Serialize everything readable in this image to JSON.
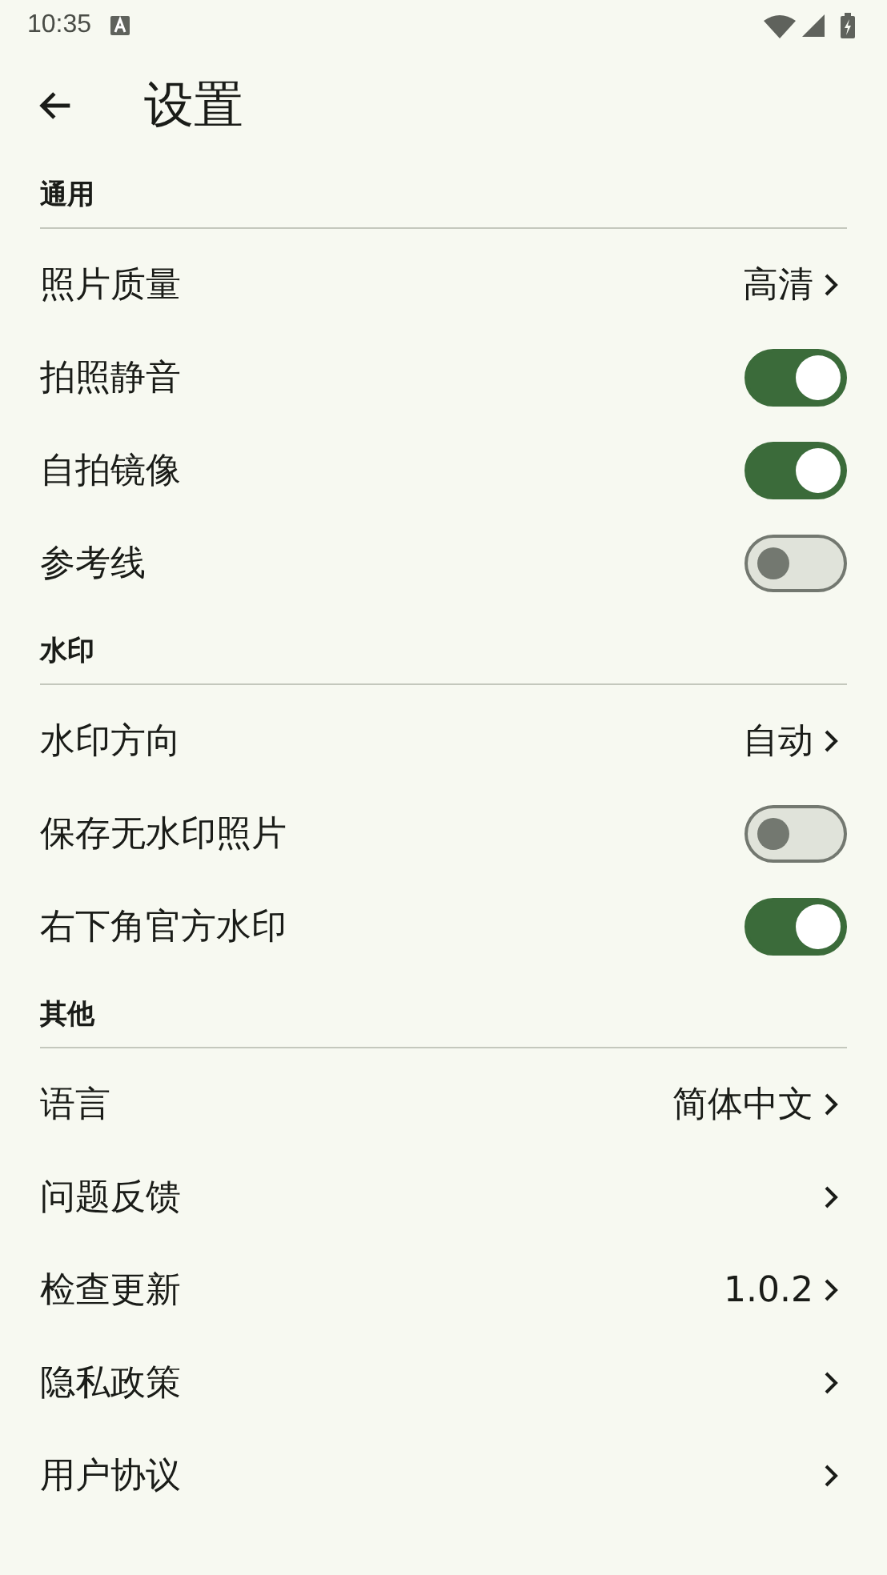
{
  "status_bar": {
    "time": "10:35"
  },
  "header": {
    "title": "设置"
  },
  "sections": [
    {
      "title": "通用",
      "items": [
        {
          "kind": "link",
          "label": "照片质量",
          "value": "高清"
        },
        {
          "kind": "toggle",
          "label": "拍照静音",
          "on": true
        },
        {
          "kind": "toggle",
          "label": "自拍镜像",
          "on": true
        },
        {
          "kind": "toggle",
          "label": "参考线",
          "on": false
        }
      ]
    },
    {
      "title": "水印",
      "items": [
        {
          "kind": "link",
          "label": "水印方向",
          "value": "自动"
        },
        {
          "kind": "toggle",
          "label": "保存无水印照片",
          "on": false
        },
        {
          "kind": "toggle",
          "label": "右下角官方水印",
          "on": true
        }
      ]
    },
    {
      "title": "其他",
      "items": [
        {
          "kind": "link",
          "label": "语言",
          "value": "简体中文"
        },
        {
          "kind": "link",
          "label": "问题反馈"
        },
        {
          "kind": "link",
          "label": "检查更新",
          "value": "1.0.2"
        },
        {
          "kind": "link",
          "label": "隐私政策"
        },
        {
          "kind": "link",
          "label": "用户协议"
        }
      ]
    }
  ]
}
